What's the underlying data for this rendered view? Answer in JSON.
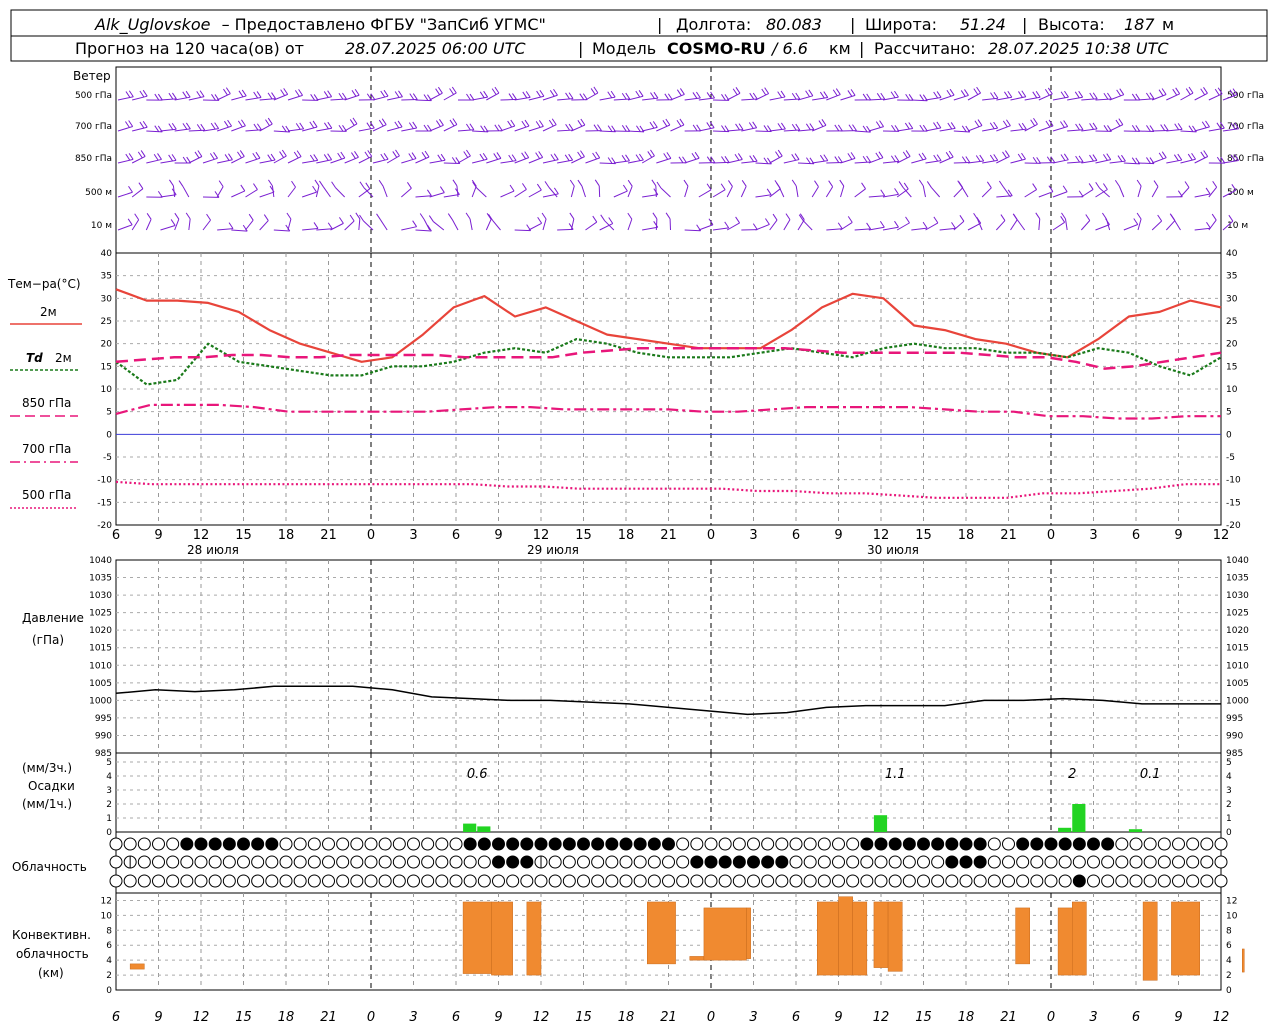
{
  "header": {
    "station": "Alk_Uglovskoe",
    "provider": "– Предоставлено ФГБУ \"ЗапСиб УГМС\"",
    "lon_label": "Долгота:",
    "lon_value": "80.083",
    "lat_label": "Широта:",
    "lat_value": "51.24",
    "alt_label": "Высота:",
    "alt_value": "187",
    "alt_unit": "м",
    "forecast_label": "Прогноз на 120 часа(ов) от",
    "forecast_start": "28.07.2025 06:00 UTC",
    "model_label": "Модель",
    "model_name": "COSMO-RU",
    "model_res": "/ 6.6",
    "model_res_unit": "км",
    "calc_label": "Рассчитано:",
    "calc_time": "28.07.2025 10:38 UTC"
  },
  "labels": {
    "wind": "Ветер",
    "temp": "Тем−ра(°C)",
    "t2m": "2м",
    "td_sym": "Td",
    "td_lev": "2м",
    "t850": "850 гПа",
    "t700": "700 гПа",
    "t500": "500 гПа",
    "pressure1": "Давление",
    "pressure2": "(гПа)",
    "precip1": "(мм/3ч.)",
    "precip2": "Осадки",
    "precip3": "(мм/1ч.)",
    "cloud": "Облачность",
    "conv1": "Конвективн.",
    "conv2": "облачность",
    "conv3": "(км)",
    "day1": "28 июля",
    "day2": "29 июля",
    "day3": "30 июля"
  },
  "colors": {
    "t2m": "#e8443a",
    "td": "#1a7a1a",
    "t850": "#e8167a",
    "t700": "#e8167a",
    "t500": "#e8167a",
    "wind": "#7a1fd1",
    "precip": "#22d422",
    "conv": "#f08a30",
    "zero": "#3b3bd8"
  },
  "chart_data": [
    {
      "type": "wind-barbs",
      "levels": [
        "500 гПа",
        "700 гПа",
        "850 гПа",
        "500 м",
        "10 м"
      ]
    },
    {
      "type": "line",
      "x_ticks": [
        "6",
        "9",
        "12",
        "15",
        "18",
        "21",
        "0",
        "3",
        "6",
        "9",
        "12",
        "15",
        "18",
        "21",
        "0",
        "3",
        "6",
        "9",
        "12",
        "15",
        "18",
        "21",
        "0",
        "3",
        "6",
        "9",
        "12"
      ],
      "ylim": [
        -20,
        40
      ],
      "yticks": [
        -20,
        -15,
        -10,
        -5,
        0,
        5,
        10,
        15,
        20,
        25,
        30,
        35,
        40
      ],
      "x_hours": [
        0,
        3,
        6,
        9,
        12,
        15,
        18,
        21,
        24,
        27,
        30,
        33,
        36,
        39,
        42,
        45,
        48,
        51,
        54,
        57,
        60,
        63,
        66,
        69,
        72,
        75,
        78
      ],
      "series": [
        {
          "name": "2м",
          "values": [
            32,
            29.5,
            29.5,
            29,
            27,
            23,
            20,
            18,
            16,
            17,
            22,
            28,
            30.5,
            26,
            28,
            25,
            22,
            21,
            20,
            19,
            19,
            19,
            23,
            28,
            31,
            30,
            24,
            23,
            21,
            20,
            18,
            17,
            21,
            26,
            27,
            29.5,
            28
          ]
        },
        {
          "name": "Td 2м",
          "values": [
            16,
            11,
            12,
            20,
            16,
            15,
            14,
            13,
            13,
            15,
            15,
            16,
            18,
            19,
            18,
            21,
            20,
            18,
            17,
            17,
            17,
            18,
            19,
            18,
            17,
            19,
            20,
            19,
            19,
            18,
            18,
            17,
            19,
            18,
            15,
            13,
            17
          ]
        },
        {
          "name": "850 гПа",
          "values": [
            16,
            16.5,
            17,
            17,
            17.5,
            17.5,
            17,
            17,
            17.5,
            17.5,
            17.5,
            17.5,
            17,
            17,
            17,
            17,
            18,
            18.5,
            19,
            19,
            19,
            19,
            19,
            19,
            18.5,
            18,
            18,
            18,
            18,
            18,
            17.5,
            17,
            17,
            16,
            14.5,
            15,
            16,
            17,
            18
          ]
        },
        {
          "name": "700 гПа",
          "values": [
            4.5,
            6.5,
            6.5,
            6.5,
            6,
            5,
            5,
            5,
            5,
            5,
            5.5,
            6,
            6,
            5.5,
            5.5,
            5.5,
            5.5,
            5,
            5,
            5.5,
            6,
            6,
            6,
            6,
            5.5,
            5,
            5,
            4,
            4,
            3.5,
            3.5,
            4,
            4
          ]
        },
        {
          "name": "500 гПа",
          "values": [
            -10.5,
            -11,
            -11,
            -11,
            -11,
            -11,
            -11,
            -11,
            -11,
            -11,
            -11,
            -11.5,
            -11.5,
            -12,
            -12,
            -12,
            -12,
            -12,
            -12.5,
            -12.5,
            -13,
            -13,
            -13.5,
            -14,
            -14,
            -14,
            -13,
            -13,
            -12.5,
            -12,
            -11,
            -11
          ]
        }
      ]
    },
    {
      "type": "line",
      "name": "Давление",
      "ylim": [
        985,
        1040
      ],
      "yticks": [
        985,
        990,
        995,
        1000,
        1005,
        1010,
        1015,
        1020,
        1025,
        1030,
        1035,
        1040
      ],
      "values": [
        1002,
        1003,
        1002.5,
        1003,
        1004,
        1004,
        1004,
        1003,
        1001,
        1000.5,
        1000,
        1000,
        999.5,
        999,
        998,
        997,
        996,
        996.5,
        998,
        998.5,
        998.5,
        998.5,
        1000,
        1000,
        1000.5,
        1000,
        999,
        999,
        999
      ]
    },
    {
      "type": "bar",
      "name": "Осадки",
      "ylim": [
        0,
        5
      ],
      "yticks": [
        0,
        1,
        2,
        3,
        4,
        5
      ],
      "bars_1h": [
        {
          "hour": 25,
          "value": 0.6
        },
        {
          "hour": 26,
          "value": 0.4
        },
        {
          "hour": 54,
          "value": 1.2
        },
        {
          "hour": 67,
          "value": 0.3
        },
        {
          "hour": 68,
          "value": 2
        },
        {
          "hour": 72,
          "value": 0.2
        }
      ],
      "totals_3h": [
        {
          "hour": 25.5,
          "label": "0.6"
        },
        {
          "hour": 55,
          "label": "1.1"
        },
        {
          "hour": 67.5,
          "label": "2"
        },
        {
          "hour": 73,
          "label": "0.1"
        }
      ]
    },
    {
      "type": "cloud-symbols",
      "name": "Облачность",
      "rows": 3,
      "cols": 79
    },
    {
      "type": "bar",
      "name": "Конвективн. облачность",
      "ylim": [
        0,
        13
      ],
      "yticks": [
        0,
        2,
        4,
        6,
        8,
        10,
        12
      ],
      "ranges": [
        {
          "h0": 1,
          "h1": 2,
          "base": 2.8,
          "top": 3.5
        },
        {
          "h0": 24.5,
          "h1": 26.5,
          "base": 2.2,
          "top": 11.8
        },
        {
          "h0": 26.5,
          "h1": 28,
          "base": 2,
          "top": 11.8
        },
        {
          "h0": 29,
          "h1": 30,
          "base": 2,
          "top": 11.8
        },
        {
          "h0": 37.5,
          "h1": 39.5,
          "base": 3.5,
          "top": 11.8
        },
        {
          "h0": 40.5,
          "h1": 41.5,
          "base": 4,
          "top": 4.5
        },
        {
          "h0": 41.5,
          "h1": 44.5,
          "base": 4,
          "top": 11
        },
        {
          "h0": 44.5,
          "h1": 44.8,
          "base": 4.2,
          "top": 11
        },
        {
          "h0": 49.5,
          "h1": 51,
          "base": 2,
          "top": 11.8
        },
        {
          "h0": 51,
          "h1": 52,
          "base": 2,
          "top": 12.5
        },
        {
          "h0": 52,
          "h1": 53,
          "base": 2,
          "top": 11.8
        },
        {
          "h0": 53.5,
          "h1": 54.5,
          "base": 3,
          "top": 11.8
        },
        {
          "h0": 54.5,
          "h1": 55.5,
          "base": 2.5,
          "top": 11.8
        },
        {
          "h0": 63.5,
          "h1": 64.5,
          "base": 3.5,
          "top": 11
        },
        {
          "h0": 66.5,
          "h1": 67.5,
          "base": 2,
          "top": 11
        },
        {
          "h0": 67.5,
          "h1": 68.5,
          "base": 2,
          "top": 11.8
        },
        {
          "h0": 72.5,
          "h1": 73.5,
          "base": 1.3,
          "top": 11.8
        },
        {
          "h0": 74.5,
          "h1": 76.5,
          "base": 2,
          "top": 11.8
        },
        {
          "h0": 79.5,
          "h1": 80,
          "base": 2.4,
          "top": 5.5
        }
      ]
    }
  ]
}
